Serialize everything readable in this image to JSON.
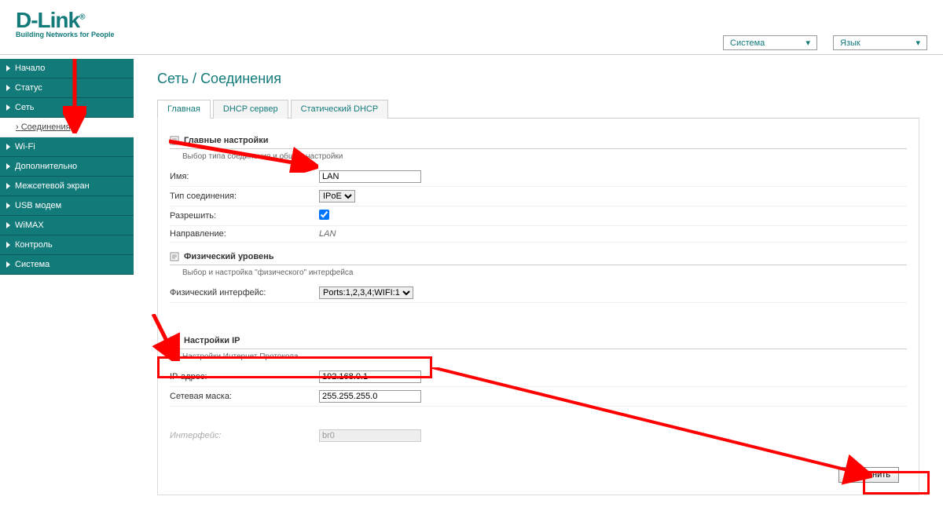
{
  "logo": {
    "brand": "D-Link",
    "slogan": "Building Networks for People"
  },
  "top_menu": {
    "system": "Система",
    "language": "Язык"
  },
  "sidebar": {
    "items": [
      {
        "label": "Начало"
      },
      {
        "label": "Статус"
      },
      {
        "label": "Сеть"
      },
      {
        "label": "Wi-Fi"
      },
      {
        "label": "Дополнительно"
      },
      {
        "label": "Межсетевой экран"
      },
      {
        "label": "USB модем"
      },
      {
        "label": "WiMAX"
      },
      {
        "label": "Контроль"
      },
      {
        "label": "Система"
      }
    ],
    "sub_connections": "Соединения"
  },
  "breadcrumb": {
    "part1": "Сеть",
    "sep": " / ",
    "part2": "Соединения"
  },
  "tabs": {
    "main": "Главная",
    "dhcp": "DHCP сервер",
    "static": "Статический DHCP"
  },
  "sections": {
    "main": {
      "title": "Главные настройки",
      "desc": "Выбор типа соединения и общие настройки",
      "fields": {
        "name_label": "Имя:",
        "name_value": "LAN",
        "type_label": "Тип соединения:",
        "type_value": "IPoE",
        "allow_label": "Разрешить:",
        "direction_label": "Направление:",
        "direction_value": "LAN"
      }
    },
    "phys": {
      "title": "Физический уровень",
      "desc": "Выбор и настройка \"физического\" интерфейса",
      "fields": {
        "iface_label": "Физический интерфейс:",
        "iface_value": "Ports:1,2,3,4;WIFI:1"
      }
    },
    "ip": {
      "title": "Настройки IP",
      "desc": "Настройки Интернет Протокола",
      "fields": {
        "ip_label": "IP-адрес:",
        "ip_value": "192.168.0.1",
        "mask_label": "Сетевая маска:",
        "mask_value": "255.255.255.0",
        "iface_label": "Интерфейс:",
        "iface_value": "br0"
      }
    }
  },
  "buttons": {
    "save": "Сохранить"
  }
}
